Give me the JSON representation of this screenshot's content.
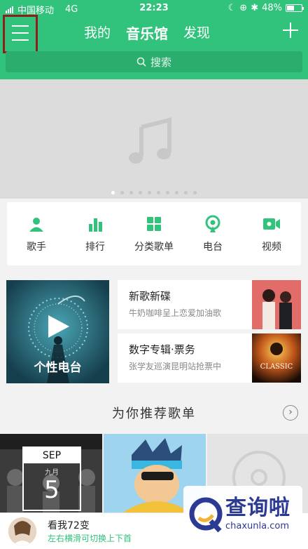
{
  "status_bar": {
    "carrier": "中国移动",
    "network": "4G",
    "time": "22:23",
    "battery": "48%"
  },
  "nav": {
    "tabs": [
      "我的",
      "音乐馆",
      "发现"
    ],
    "active_tab": "音乐馆"
  },
  "search": {
    "placeholder": "搜索"
  },
  "banner": {
    "page_count": 10,
    "active_index": 0
  },
  "categories": [
    {
      "label": "歌手",
      "icon": "singer-icon"
    },
    {
      "label": "排行",
      "icon": "chart-icon"
    },
    {
      "label": "分类歌单",
      "icon": "grid-icon"
    },
    {
      "label": "电台",
      "icon": "radio-icon"
    },
    {
      "label": "视频",
      "icon": "video-icon"
    }
  ],
  "radio": {
    "label": "个性电台"
  },
  "albums": [
    {
      "title": "新歌新碟",
      "subtitle": "牛奶咖啡呈上恋爱加油歌"
    },
    {
      "title": "数字专辑·票务",
      "subtitle": "张学友巡演昆明站抢票中",
      "cover_text": "CLASSIC"
    }
  ],
  "recommend": {
    "title": "为你推荐歌单",
    "tiles": [
      {
        "calendar_month": "SEP",
        "calendar_sub": "九月",
        "calendar_day": "5"
      }
    ]
  },
  "player": {
    "title": "看我72变",
    "subtitle": "左右横滑可切换上下首"
  },
  "watermark": {
    "text": "查询啦",
    "url": "chaxunla.com"
  },
  "colors": {
    "brand": "#31c27c",
    "highlight_border": "#8b1f1a"
  }
}
